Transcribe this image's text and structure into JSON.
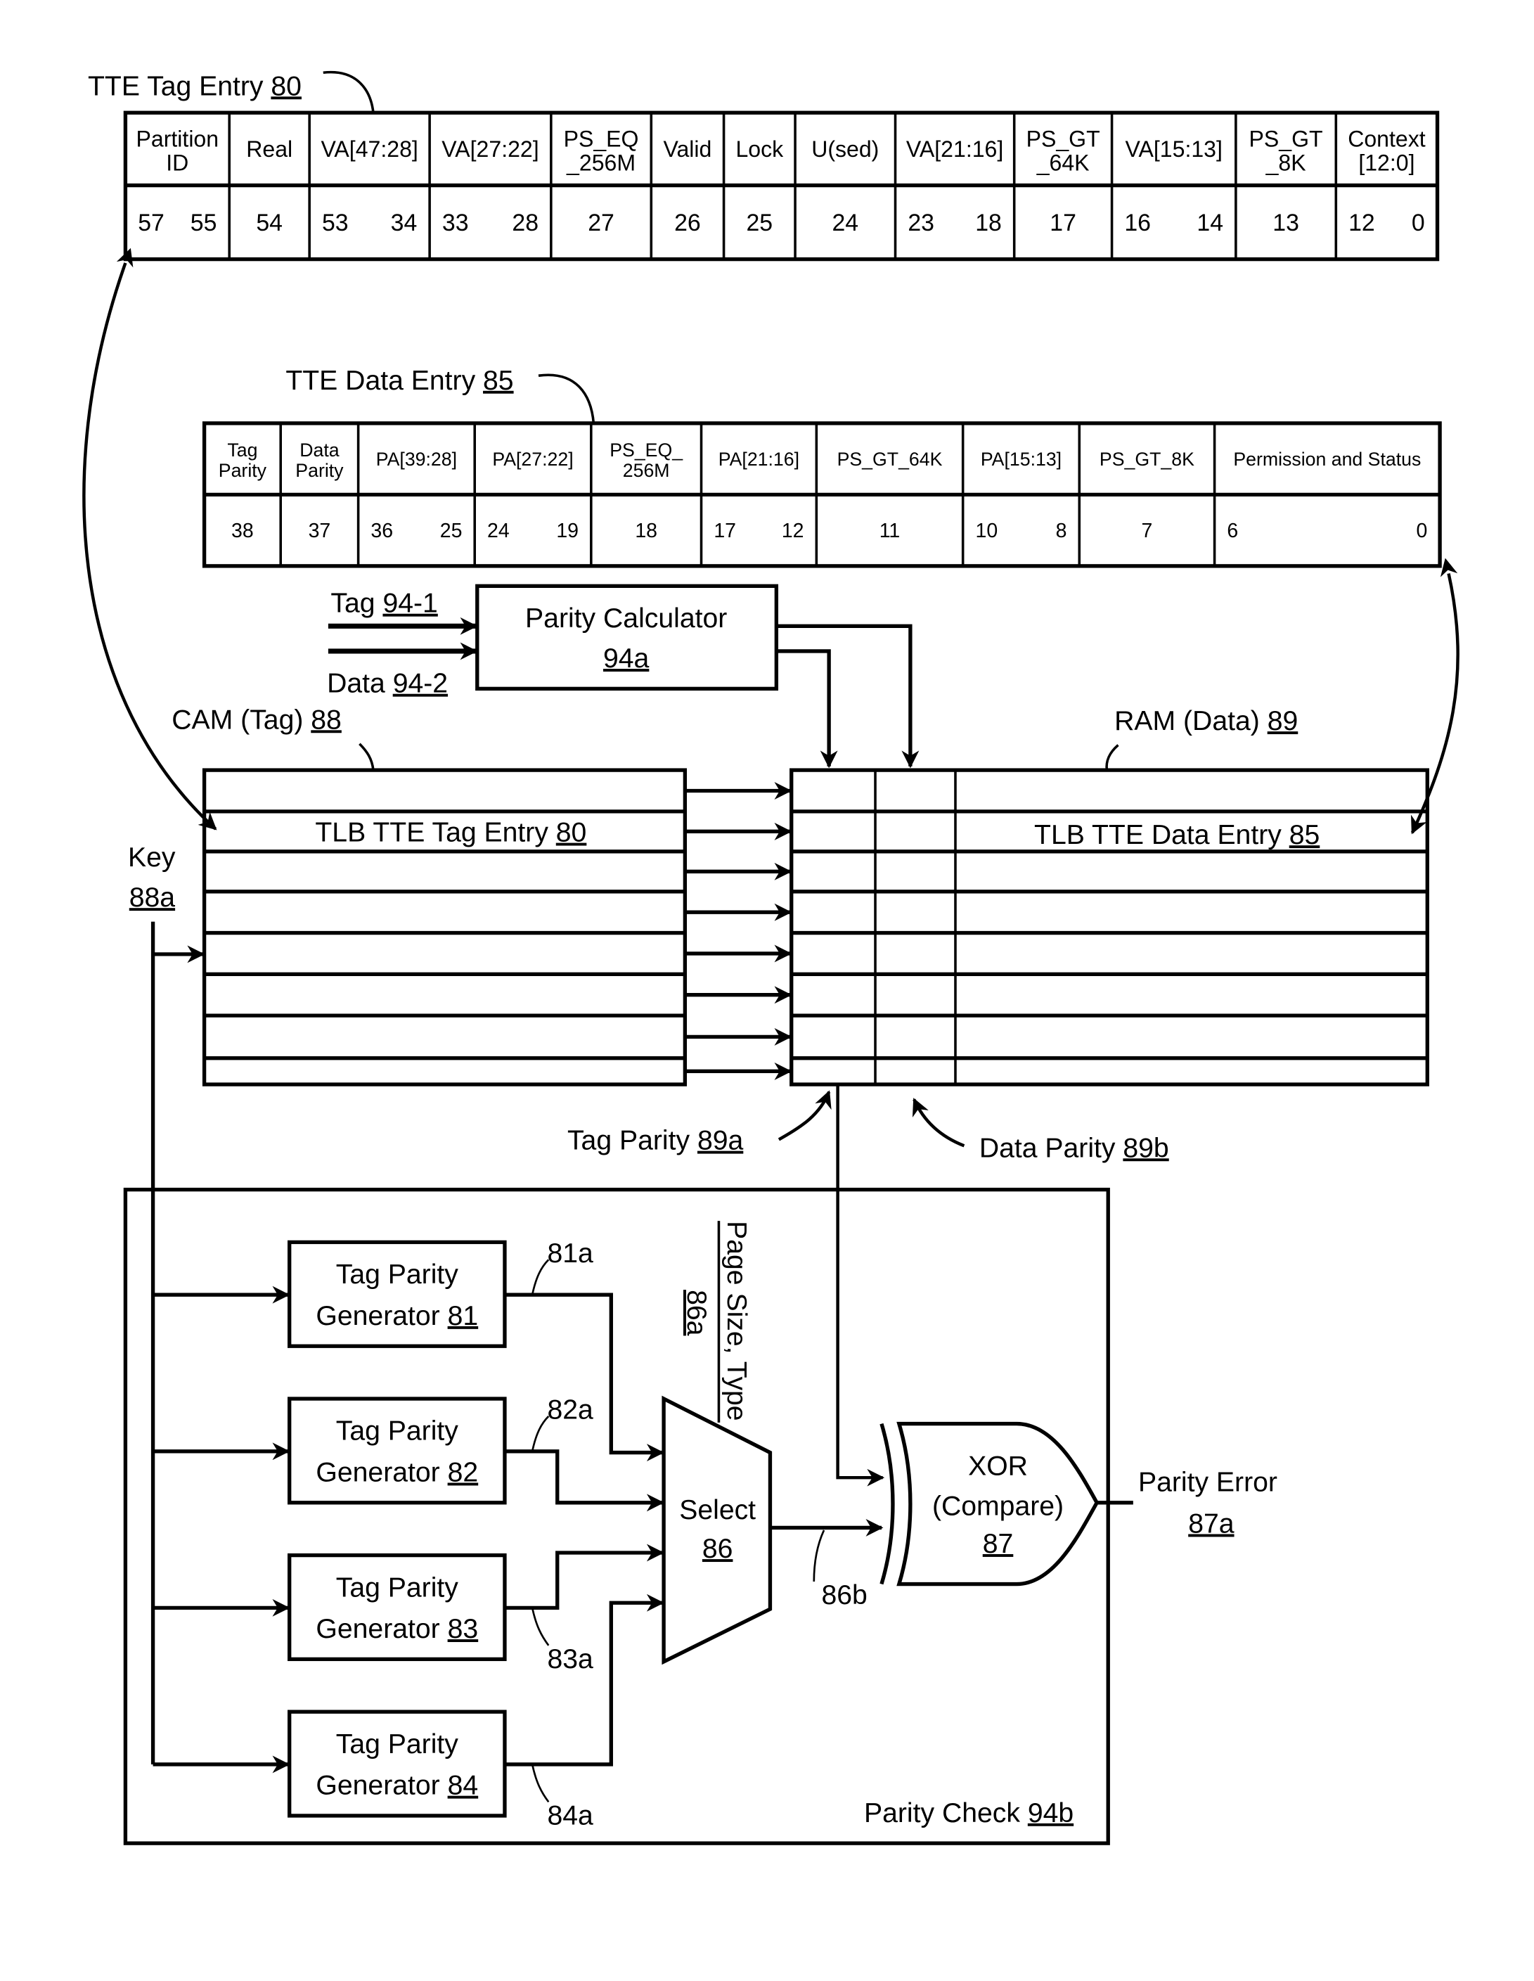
{
  "tag_entry": {
    "title": "TTE Tag Entry ",
    "ref": "80",
    "fields": [
      {
        "name": [
          "Partition",
          "ID"
        ],
        "hi": "57",
        "lo": "55"
      },
      {
        "name": [
          "Real"
        ],
        "bit": "54"
      },
      {
        "name": [
          "VA[47:28]"
        ],
        "hi": "53",
        "lo": "34"
      },
      {
        "name": [
          "VA[27:22]"
        ],
        "hi": "33",
        "lo": "28"
      },
      {
        "name": [
          "PS_EQ",
          "_256M"
        ],
        "bit": "27"
      },
      {
        "name": [
          "Valid"
        ],
        "bit": "26"
      },
      {
        "name": [
          "Lock"
        ],
        "bit": "25"
      },
      {
        "name": [
          "U(sed)"
        ],
        "bit": "24"
      },
      {
        "name": [
          "VA[21:16]"
        ],
        "hi": "23",
        "lo": "18"
      },
      {
        "name": [
          "PS_GT",
          "_64K"
        ],
        "bit": "17"
      },
      {
        "name": [
          "VA[15:13]"
        ],
        "hi": "16",
        "lo": "14"
      },
      {
        "name": [
          "PS_GT",
          "_8K"
        ],
        "bit": "13"
      },
      {
        "name": [
          "Context",
          "[12:0]"
        ],
        "hi": "12",
        "lo": "0"
      }
    ]
  },
  "data_entry": {
    "title": "TTE Data Entry ",
    "ref": "85",
    "fields": [
      {
        "name": [
          "Tag",
          "Parity"
        ],
        "bit": "38"
      },
      {
        "name": [
          "Data",
          "Parity"
        ],
        "bit": "37"
      },
      {
        "name": [
          "PA[39:28]"
        ],
        "hi": "36",
        "lo": "25"
      },
      {
        "name": [
          "PA[27:22]"
        ],
        "hi": "24",
        "lo": "19"
      },
      {
        "name": [
          "PS_EQ_",
          "256M"
        ],
        "bit": "18"
      },
      {
        "name": [
          "PA[21:16]"
        ],
        "hi": "17",
        "lo": "12"
      },
      {
        "name": [
          "PS_GT_64K"
        ],
        "bit": "11"
      },
      {
        "name": [
          "PA[15:13]"
        ],
        "hi": "10",
        "lo": "8"
      },
      {
        "name": [
          "PS_GT_8K"
        ],
        "bit": "7"
      },
      {
        "name": [
          "Permission and Status"
        ],
        "hi": "6",
        "lo": "0"
      }
    ]
  },
  "parity_calculator": {
    "label": "Parity Calculator",
    "ref": "94a"
  },
  "inputs": {
    "tag": {
      "label": "Tag ",
      "ref": "94-1"
    },
    "data": {
      "label": "Data ",
      "ref": "94-2"
    }
  },
  "cam": {
    "label": "CAM (Tag) ",
    "ref": "88",
    "entry_label": "TLB TTE Tag Entry ",
    "entry_ref": "80",
    "rows": 8
  },
  "ram": {
    "label": "RAM (Data) ",
    "ref": "89",
    "entry_label": "TLB TTE Data Entry ",
    "entry_ref": "85",
    "rows": 8
  },
  "key": {
    "label": "Key",
    "ref": "88a"
  },
  "tag_parity": {
    "label": "Tag Parity ",
    "ref": "89a"
  },
  "data_parity": {
    "label": "Data Parity ",
    "ref": "89b"
  },
  "parity_check": {
    "label": "Parity Check ",
    "ref": "94b"
  },
  "generators": [
    {
      "label": "Tag Parity",
      "label2": "Generator ",
      "ref": "81",
      "out": "81a"
    },
    {
      "label": "Tag Parity",
      "label2": "Generator ",
      "ref": "82",
      "out": "82a"
    },
    {
      "label": "Tag Parity",
      "label2": "Generator ",
      "ref": "83",
      "out": "83a"
    },
    {
      "label": "Tag Parity",
      "label2": "Generator ",
      "ref": "84",
      "out": "84a"
    }
  ],
  "page_size": {
    "label": "Page Size, Type",
    "ref": "86a"
  },
  "select": {
    "label": "Select",
    "ref": "86",
    "out": "86b"
  },
  "xor": {
    "label": "XOR",
    "label2": "(Compare)",
    "ref": "87"
  },
  "parity_error": {
    "label": "Parity Error",
    "ref": "87a"
  }
}
